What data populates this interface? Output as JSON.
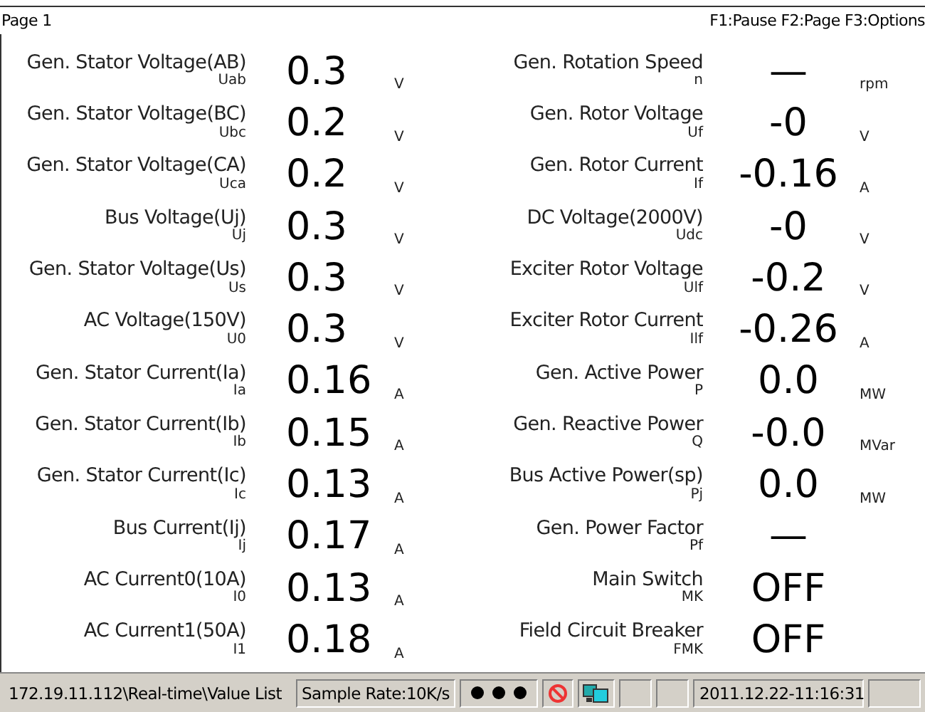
{
  "header": {
    "page": "Page 1",
    "keys": "F1:Pause F2:Page F3:Options"
  },
  "left_column": [
    {
      "label": "Gen. Stator Voltage(AB)",
      "symbol": "Uab",
      "value": "0.3",
      "unit": "V"
    },
    {
      "label": "Gen. Stator Voltage(BC)",
      "symbol": "Ubc",
      "value": "0.2",
      "unit": "V"
    },
    {
      "label": "Gen. Stator Voltage(CA)",
      "symbol": "Uca",
      "value": "0.2",
      "unit": "V"
    },
    {
      "label": "Bus Voltage(Uj)",
      "symbol": "Uj",
      "value": "0.3",
      "unit": "V"
    },
    {
      "label": "Gen. Stator Voltage(Us)",
      "symbol": "Us",
      "value": "0.3",
      "unit": "V"
    },
    {
      "label": "AC Voltage(150V)",
      "symbol": "U0",
      "value": "0.3",
      "unit": "V"
    },
    {
      "label": "Gen. Stator Current(Ia)",
      "symbol": "Ia",
      "value": "0.16",
      "unit": "A"
    },
    {
      "label": "Gen. Stator Current(Ib)",
      "symbol": "Ib",
      "value": "0.15",
      "unit": "A"
    },
    {
      "label": "Gen. Stator Current(Ic)",
      "symbol": "Ic",
      "value": "0.13",
      "unit": "A"
    },
    {
      "label": "Bus Current(Ij)",
      "symbol": "Ij",
      "value": "0.17",
      "unit": "A"
    },
    {
      "label": "AC Current0(10A)",
      "symbol": "I0",
      "value": "0.13",
      "unit": "A"
    },
    {
      "label": "AC Current1(50A)",
      "symbol": "I1",
      "value": "0.18",
      "unit": "A"
    }
  ],
  "right_column": [
    {
      "label": "Gen. Rotation Speed",
      "symbol": "n",
      "value": "—",
      "unit": "rpm"
    },
    {
      "label": "Gen. Rotor Voltage",
      "symbol": "Uf",
      "value": "-0",
      "unit": "V"
    },
    {
      "label": "Gen. Rotor Current",
      "symbol": "If",
      "value": "-0.16",
      "unit": "A"
    },
    {
      "label": "DC Voltage(2000V)",
      "symbol": "Udc",
      "value": "-0",
      "unit": "V"
    },
    {
      "label": "Exciter Rotor Voltage",
      "symbol": "Ulf",
      "value": "-0.2",
      "unit": "V"
    },
    {
      "label": "Exciter Rotor Current",
      "symbol": "Ilf",
      "value": "-0.26",
      "unit": "A"
    },
    {
      "label": "Gen. Active Power",
      "symbol": "P",
      "value": "0.0",
      "unit": "MW"
    },
    {
      "label": "Gen. Reactive Power",
      "symbol": "Q",
      "value": "-0.0",
      "unit": "MVar"
    },
    {
      "label": "Bus Active Power(sp)",
      "symbol": "Pj",
      "value": "0.0",
      "unit": "MW"
    },
    {
      "label": "Gen. Power Factor",
      "symbol": "Pf",
      "value": "—"
    },
    {
      "label": "Main Switch",
      "symbol": "MK",
      "value": "OFF"
    },
    {
      "label": "Field Circuit Breaker",
      "symbol": "FMK",
      "value": "OFF"
    }
  ],
  "status_bar": {
    "path": "172.19.11.112\\Real-time\\Value List",
    "sample_rate": "Sample Rate:10K/s",
    "datetime": "2011.12.22-11:16:31"
  }
}
